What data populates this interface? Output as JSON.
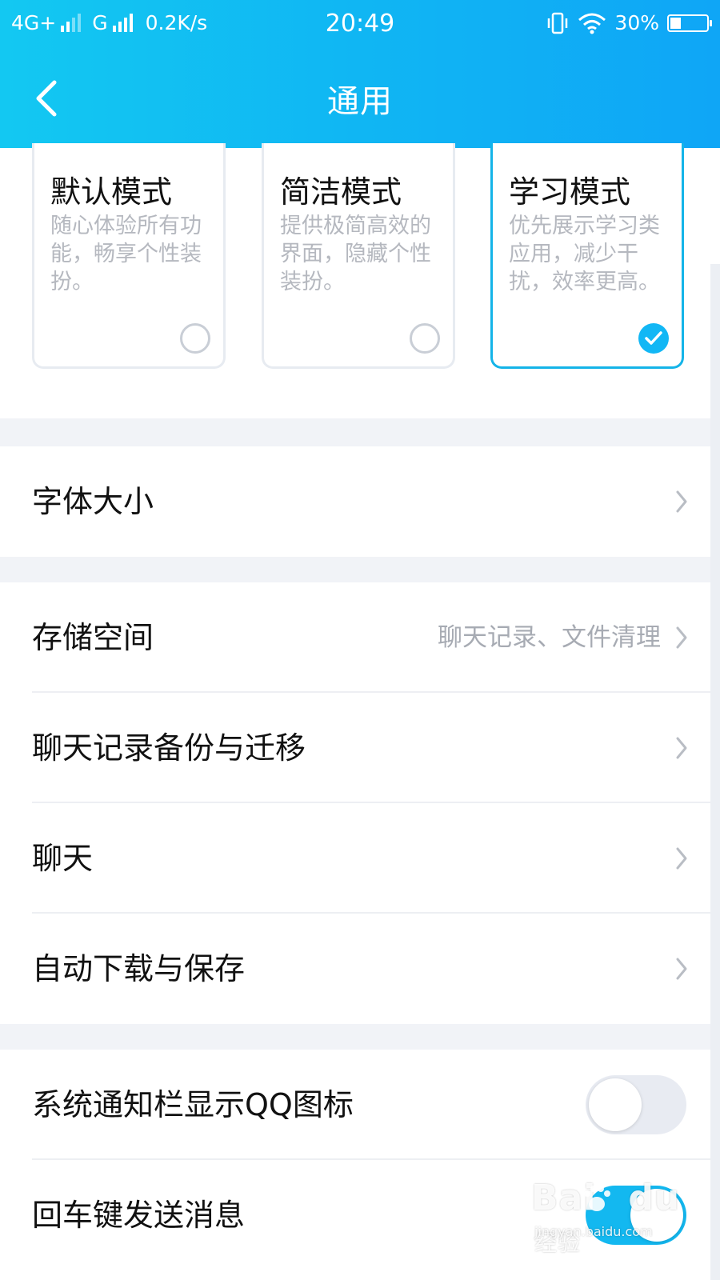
{
  "status_bar": {
    "network1": "4G+",
    "network2": "G",
    "speed": "0.2K/s",
    "time": "20:49",
    "battery": "30%",
    "battery_level": 0.3
  },
  "header": {
    "title": "通用"
  },
  "modes": [
    {
      "name": "默认模式",
      "desc": "随心体验所有功能，畅享个性装扮。",
      "selected": false
    },
    {
      "name": "简洁模式",
      "desc": "提供极简高效的界面，隐藏个性装扮。",
      "selected": false
    },
    {
      "name": "学习模式",
      "desc": "优先展示学习类应用，减少干扰，效率更高。",
      "selected": true
    }
  ],
  "settings": {
    "font_size": "字体大小",
    "storage": "存储空间",
    "storage_hint": "聊天记录、文件清理",
    "chat_backup": "聊天记录备份与迁移",
    "chat": "聊天",
    "auto_download": "自动下载与保存",
    "notification_icon": "系统通知栏显示QQ图标",
    "enter_send": "回车键发送消息"
  },
  "toggles": {
    "notification_icon": false,
    "enter_send": true
  },
  "watermark": {
    "main": "Bai",
    "main2": "du",
    "cn": "经验",
    "sub": "jingyan.baidu.com"
  },
  "colors": {
    "accent": "#12b7f5",
    "header_start": "#13c8f2",
    "header_end": "#0fa6f6"
  }
}
